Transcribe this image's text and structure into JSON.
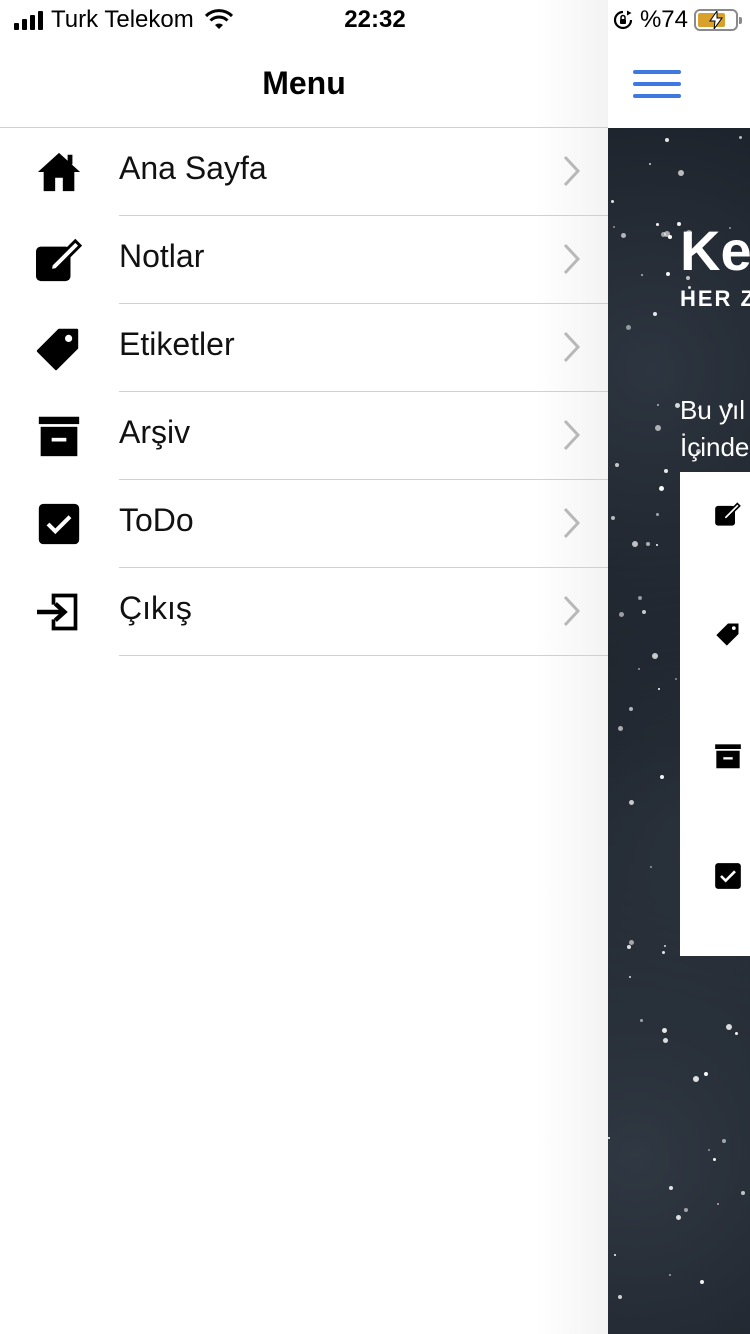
{
  "status_bar": {
    "carrier": "Turk Telekom",
    "time": "22:32",
    "battery_text": "%74",
    "battery_level": 0.74,
    "icons": [
      "cellular-signal-icon",
      "wifi-icon",
      "rotation-lock-icon",
      "battery-charging-icon"
    ]
  },
  "drawer": {
    "title": "Menu",
    "items": [
      {
        "label": "Ana Sayfa",
        "icon": "home-icon"
      },
      {
        "label": "Notlar",
        "icon": "edit-note-icon"
      },
      {
        "label": "Etiketler",
        "icon": "tag-icon"
      },
      {
        "label": "Arşiv",
        "icon": "archive-icon"
      },
      {
        "label": "ToDo",
        "icon": "checkbox-icon"
      },
      {
        "label": "Çıkış",
        "icon": "logout-icon"
      }
    ]
  },
  "background_screen": {
    "heading_partial": "Ke",
    "subheading_partial": "HER Z",
    "text_line1_partial": "Bu yıl",
    "text_line2_partial": "İçinde",
    "accent_color": "#3f78e0",
    "card_icons": [
      "edit-note-icon",
      "tag-icon",
      "archive-icon",
      "checkbox-icon"
    ]
  }
}
